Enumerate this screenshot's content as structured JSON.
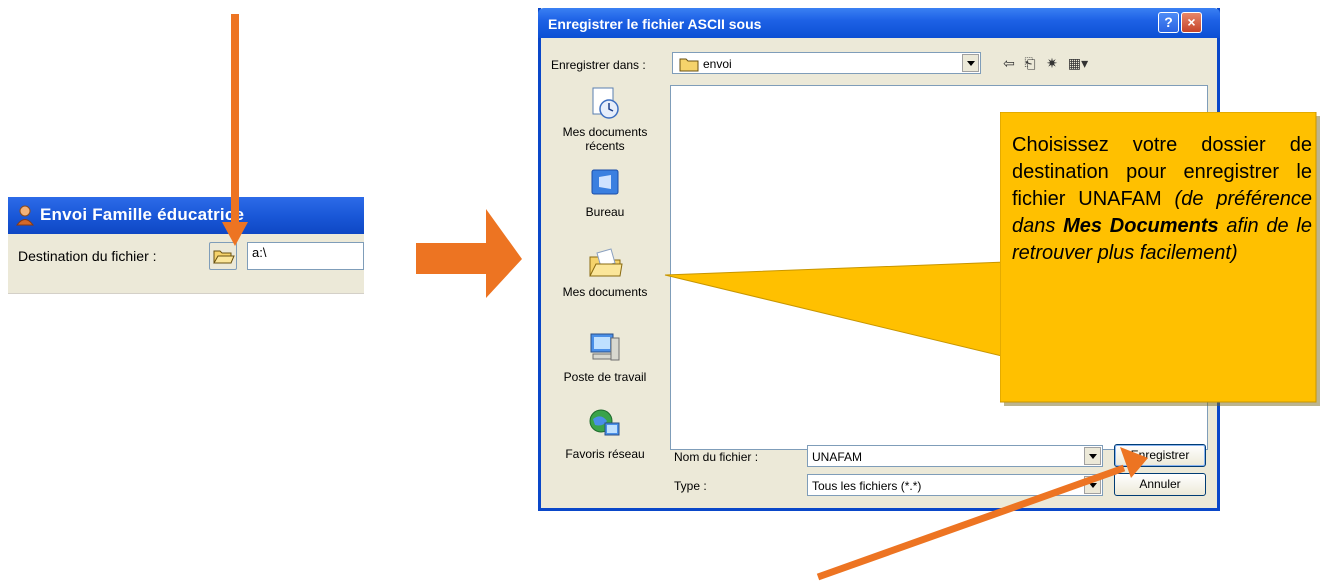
{
  "fragment": {
    "title": "Envoi Famille éducatrice",
    "destination_label": "Destination du fichier :",
    "destination_value": "a:\\"
  },
  "dialog": {
    "title": "Enregistrer le fichier ASCII sous",
    "help_glyph": "?",
    "close_glyph": "×",
    "lookin_label": "Enregistrer dans :",
    "lookin_value": "envoi",
    "places": [
      {
        "label": "Mes documents récents",
        "icon": "recent-documents-icon"
      },
      {
        "label": "Bureau",
        "icon": "desktop-icon"
      },
      {
        "label": "Mes documents",
        "icon": "my-documents-icon"
      },
      {
        "label": "Poste de travail",
        "icon": "my-computer-icon"
      },
      {
        "label": "Favoris réseau",
        "icon": "network-places-icon"
      }
    ],
    "filename_label": "Nom du fichier :",
    "filename_value": "UNAFAM",
    "filetype_label": "Type :",
    "filetype_value": "Tous les fichiers (*.*)",
    "save_label": "Enregistrer",
    "cancel_label": "Annuler"
  },
  "callout": {
    "part1": "Choisissez votre dossier de destination pour enregistrer le fichier UNAFAM ",
    "part2": "(de préférence dans ",
    "part3": "Mes Documents",
    "part4": " afin de le retrouver plus facilement)"
  },
  "colors": {
    "arrow": "#ed7422",
    "callout_fill": "#ffc000",
    "xp_blue": "#0a47c9"
  }
}
